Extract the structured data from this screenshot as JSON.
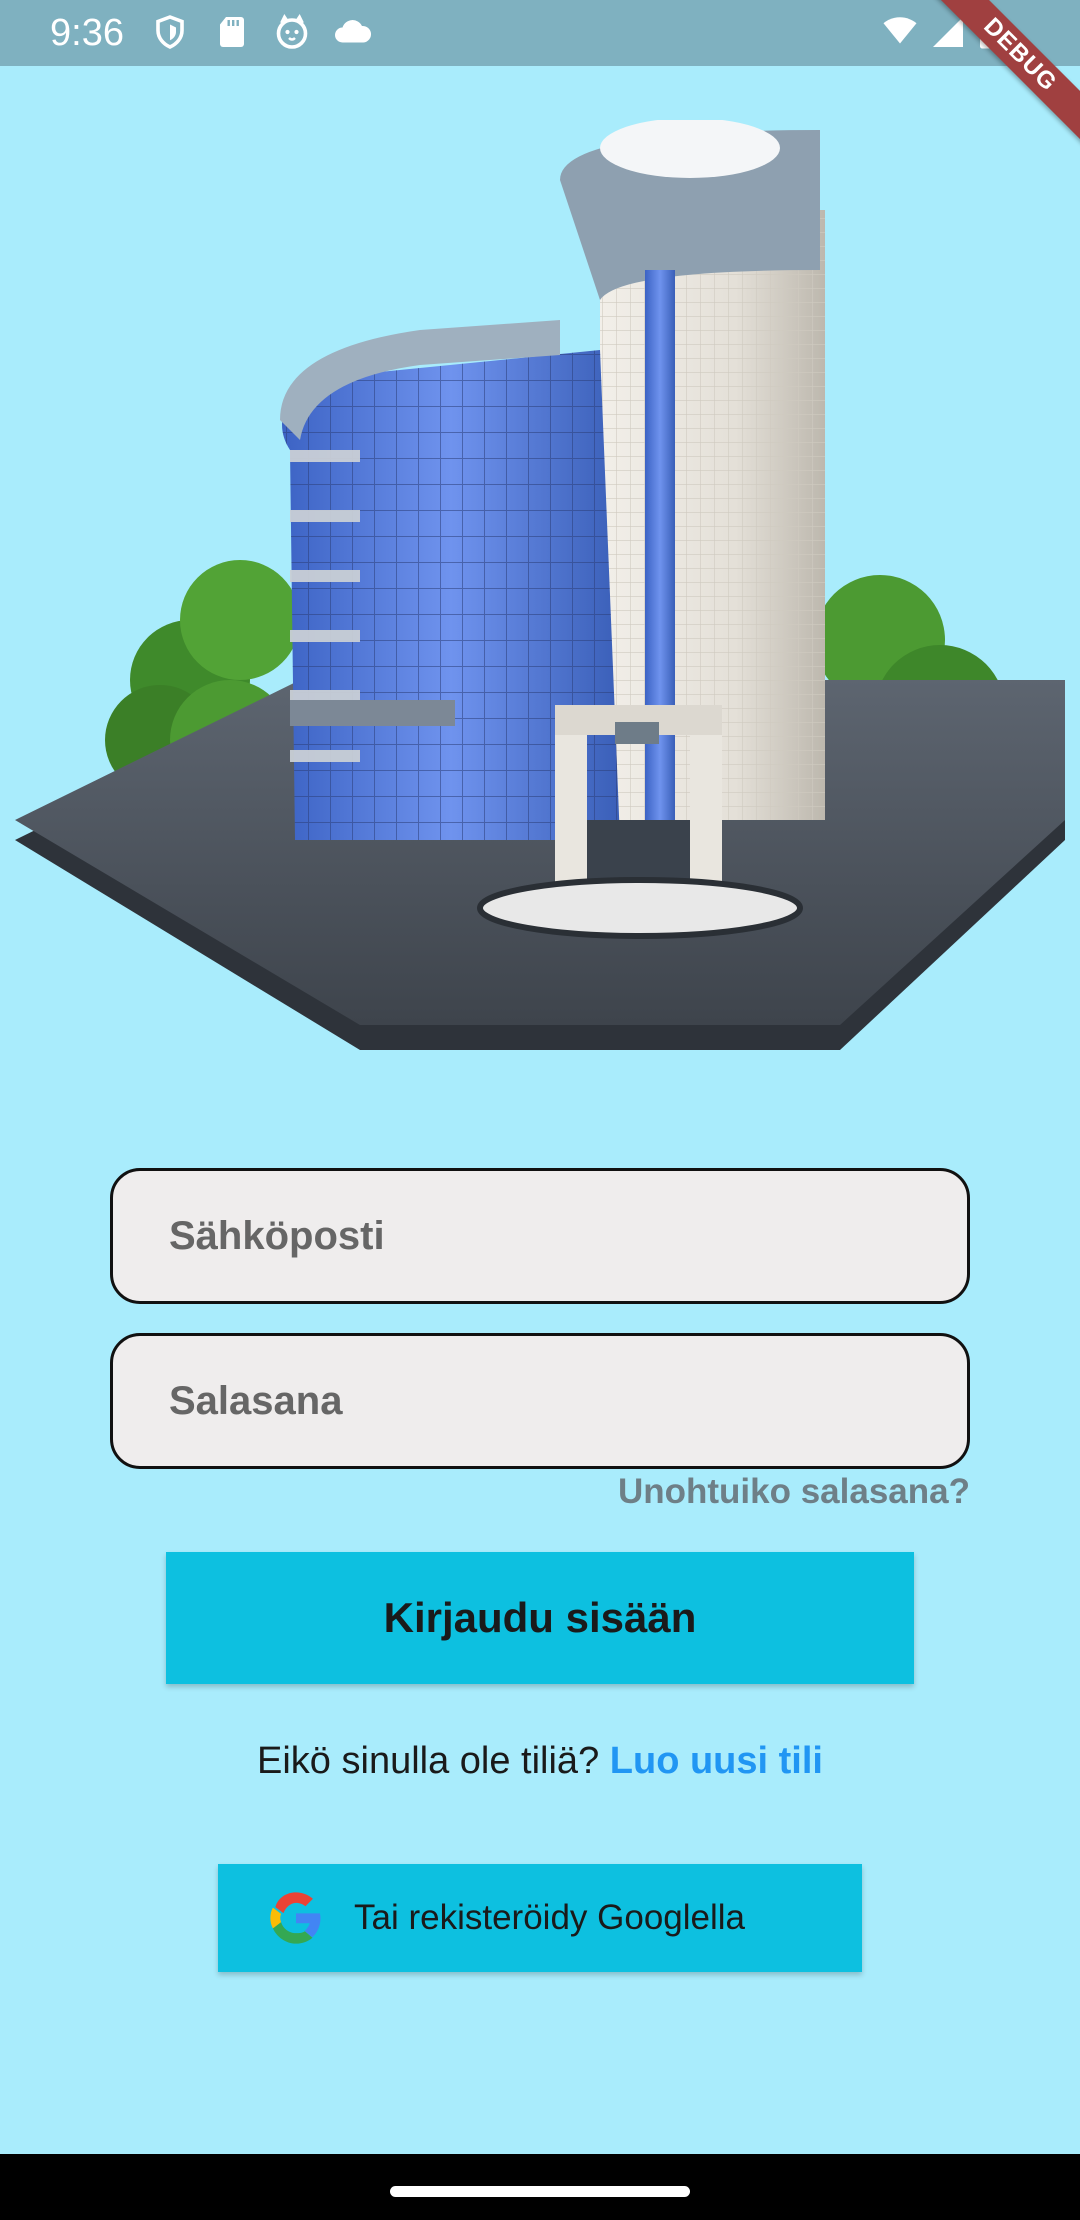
{
  "status_bar": {
    "time": "9:36",
    "left_icons": [
      "shield-icon",
      "sd-card-icon",
      "cat-face-icon",
      "cloud-icon"
    ],
    "right_icons": [
      "wifi-icon",
      "signal-icon",
      "battery-icon"
    ],
    "debug_label": "DEBUG"
  },
  "hero": {
    "image": "office-building-illustration"
  },
  "form": {
    "email_placeholder": "Sähköposti",
    "email_value": "",
    "password_placeholder": "Salasana",
    "password_value": "",
    "forgot_password": "Unohtuiko salasana?",
    "login_button": "Kirjaudu sisään",
    "no_account_text": "Eikö sinulla ole tiliä?",
    "create_account_link": "Luo uusi tili",
    "google_button": "Tai rekisteröidy Googlella"
  },
  "colors": {
    "background": "#a9ecfc",
    "status_bar": "#7fb1c0",
    "primary_button": "#0dc0e0",
    "link": "#2196f3",
    "muted_link": "#6e7f87",
    "field_bg": "#efeded"
  }
}
